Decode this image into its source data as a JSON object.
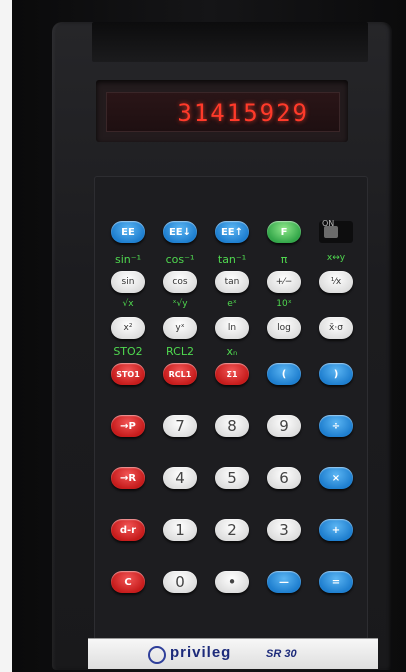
{
  "display": {
    "value": "31415929"
  },
  "switch_label": "ON",
  "rows": [
    {
      "labels": [
        "sin⁻¹",
        "cos⁻¹",
        "tan⁻¹",
        "π",
        "x↔y"
      ],
      "keys": [
        {
          "label": "sin",
          "color": "white"
        },
        {
          "label": "cos",
          "color": "white"
        },
        {
          "label": "tan",
          "color": "white"
        },
        {
          "label": "+⁄−",
          "color": "white"
        },
        {
          "label": "¹⁄x",
          "color": "white"
        }
      ]
    },
    {
      "labels": [
        "√x",
        "ˣ√y",
        "eˣ",
        "10ˣ",
        ""
      ],
      "keys": [
        {
          "label": "x²",
          "color": "white"
        },
        {
          "label": "yˣ",
          "color": "white"
        },
        {
          "label": "ln",
          "color": "white"
        },
        {
          "label": "log",
          "color": "white"
        },
        {
          "label": "x̄·σ",
          "color": "white"
        }
      ]
    },
    {
      "labels": [
        "STO2",
        "RCL2",
        "xₙ",
        "",
        ""
      ],
      "keys": [
        {
          "label": "STO1",
          "color": "red"
        },
        {
          "label": "RCL1",
          "color": "red"
        },
        {
          "label": "Σ1",
          "color": "red"
        },
        {
          "label": "(",
          "color": "blue"
        },
        {
          "label": ")",
          "color": "blue"
        }
      ]
    }
  ],
  "top_keys": [
    {
      "label": "EE",
      "color": "blue"
    },
    {
      "label": "EE↓",
      "color": "blue"
    },
    {
      "label": "EE↑",
      "color": "blue"
    },
    {
      "label": "F",
      "color": "green"
    }
  ],
  "number_rows": [
    [
      {
        "label": "→P",
        "color": "red"
      },
      {
        "label": "7",
        "color": "white"
      },
      {
        "label": "8",
        "color": "white"
      },
      {
        "label": "9",
        "color": "white"
      },
      {
        "label": "÷",
        "color": "blue"
      }
    ],
    [
      {
        "label": "→R",
        "color": "red"
      },
      {
        "label": "4",
        "color": "white"
      },
      {
        "label": "5",
        "color": "white"
      },
      {
        "label": "6",
        "color": "white"
      },
      {
        "label": "×",
        "color": "blue"
      }
    ],
    [
      {
        "label": "d-r",
        "color": "red"
      },
      {
        "label": "1",
        "color": "white"
      },
      {
        "label": "2",
        "color": "white"
      },
      {
        "label": "3",
        "color": "white"
      },
      {
        "label": "+",
        "color": "blue"
      }
    ],
    [
      {
        "label": "C",
        "color": "red"
      },
      {
        "label": "0",
        "color": "white"
      },
      {
        "label": "•",
        "color": "white"
      },
      {
        "label": "—",
        "color": "blue"
      },
      {
        "label": "=",
        "color": "blue"
      }
    ]
  ],
  "brand": {
    "name": "privileg",
    "model": "SR 30"
  }
}
